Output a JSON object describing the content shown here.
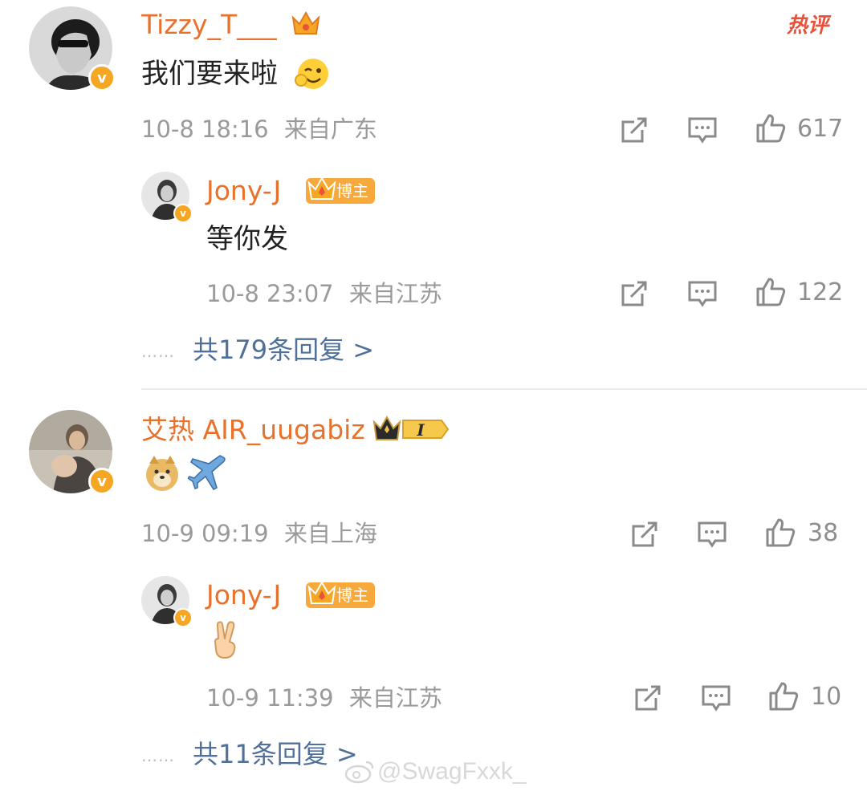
{
  "hot_label": "热评",
  "comments": [
    {
      "username": "Tizzy_T___",
      "text": "我们要来啦",
      "time": "10-8 18:16",
      "location": "来自广东",
      "likes": "617",
      "reply": {
        "username": "Jony-J",
        "badge": "博主",
        "text": "等你发",
        "time": "10-8 23:07",
        "location": "来自江苏",
        "likes": "122"
      },
      "more_dots": "……",
      "more_replies": "共179条回复 >"
    },
    {
      "username": "艾热 AIR_uugabiz",
      "level_badge": "I",
      "emoji_text": [
        "doge-emoji",
        "airplane-emoji"
      ],
      "time": "10-9 09:19",
      "location": "来自上海",
      "likes": "38",
      "reply": {
        "username": "Jony-J",
        "badge": "博主",
        "emoji_text": [
          "victory-hand-emoji"
        ],
        "time": "10-9 11:39",
        "location": "来自江苏",
        "likes": "10"
      },
      "more_dots": "……",
      "more_replies": "共11条回复 >"
    }
  ],
  "watermark": "@SwagFxxk_",
  "colors": {
    "username": "#e8722c",
    "meta": "#9a9a9a",
    "link": "#50709a",
    "badge": "#f7a93c",
    "hot": "#e8513a"
  }
}
